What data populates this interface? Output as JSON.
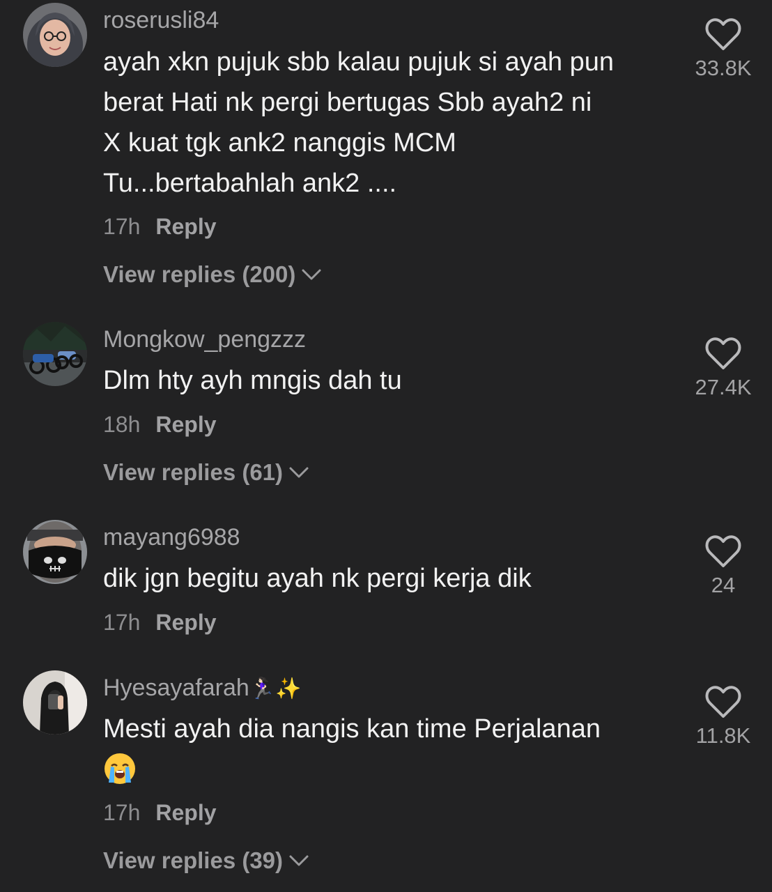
{
  "comments": [
    {
      "username": "roserusli84",
      "text_lines": [
        "ayah xkn pujuk sbb kalau pujuk si ayah pun",
        "berat Hati nk pergi bertugas Sbb ayah2 ni",
        "X kuat tgk ank2 nanggis MCM",
        "Tu...bertabahlah ank2 ...."
      ],
      "time": "17h",
      "reply_label": "Reply",
      "view_replies": "View replies (200)",
      "likes": "33.8K",
      "avatar_icon": "woman-hijab-glasses-avatar"
    },
    {
      "username": "Mongkow_pengzzz",
      "text_lines": [
        "Dlm hty ayh mngis dah tu"
      ],
      "time": "18h",
      "reply_label": "Reply",
      "view_replies": "View replies (61)",
      "likes": "27.4K",
      "avatar_icon": "motorcycles-night-avatar"
    },
    {
      "username": "mayang6988",
      "text_lines": [
        "dik jgn begitu ayah nk pergi kerja dik"
      ],
      "time": "17h",
      "reply_label": "Reply",
      "likes": "24",
      "avatar_icon": "skull-mask-avatar"
    },
    {
      "username": "Hyesayafarah",
      "username_emojis": "🏃🏻‍♀️✨",
      "text_lines": [
        "Mesti ayah dia nangis kan time Perjalanan"
      ],
      "text_emoji": "loudly-crying-face-emoji",
      "time": "17h",
      "reply_label": "Reply",
      "view_replies": "View replies (39)",
      "likes": "11.8K",
      "avatar_icon": "mirror-selfie-avatar"
    }
  ],
  "colors": {
    "background": "#222223",
    "username": "#a6a6a8",
    "text": "#f2f2f2",
    "muted": "#8e8e90"
  }
}
